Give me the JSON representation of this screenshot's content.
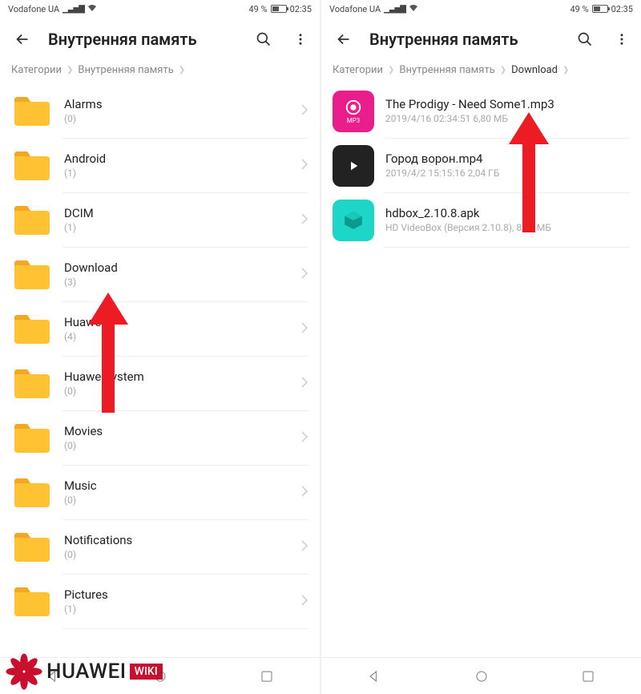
{
  "status": {
    "carrier": "Vodafone UA",
    "battery_text": "49 %",
    "time": "02:35"
  },
  "left": {
    "title": "Внутренняя память",
    "breadcrumb": [
      "Категории",
      "Внутренняя память"
    ],
    "folders": [
      {
        "name": "Alarms",
        "count": "(0)"
      },
      {
        "name": "Android",
        "count": "(1)"
      },
      {
        "name": "DCIM",
        "count": "(1)"
      },
      {
        "name": "Download",
        "count": "(3)"
      },
      {
        "name": "Huawei",
        "count": "(4)"
      },
      {
        "name": "HuaweiSystem",
        "count": "(0)"
      },
      {
        "name": "Movies",
        "count": "(0)"
      },
      {
        "name": "Music",
        "count": "(0)"
      },
      {
        "name": "Notifications",
        "count": "(0)"
      },
      {
        "name": "Pictures",
        "count": "(1)"
      }
    ]
  },
  "right": {
    "title": "Внутренняя память",
    "breadcrumb": [
      "Категории",
      "Внутренняя память",
      "Download"
    ],
    "files": [
      {
        "name": "The Prodigy - Need Some1.mp3",
        "sub": "2019/4/16 02:34:51 6,80 МБ",
        "type": "mp3"
      },
      {
        "name": "Город ворон.mp4",
        "sub": "2019/4/2 15:15:16 2,04 ГБ",
        "type": "mp4"
      },
      {
        "name": "hdbox_2.10.8.apk",
        "sub": "HD VideoBox (Версия 2.10.8), 8,47 МБ",
        "type": "apk"
      }
    ]
  },
  "mp3_label": "MP3",
  "logo": {
    "brand": "HUAWEI",
    "wiki": "WIKI"
  }
}
